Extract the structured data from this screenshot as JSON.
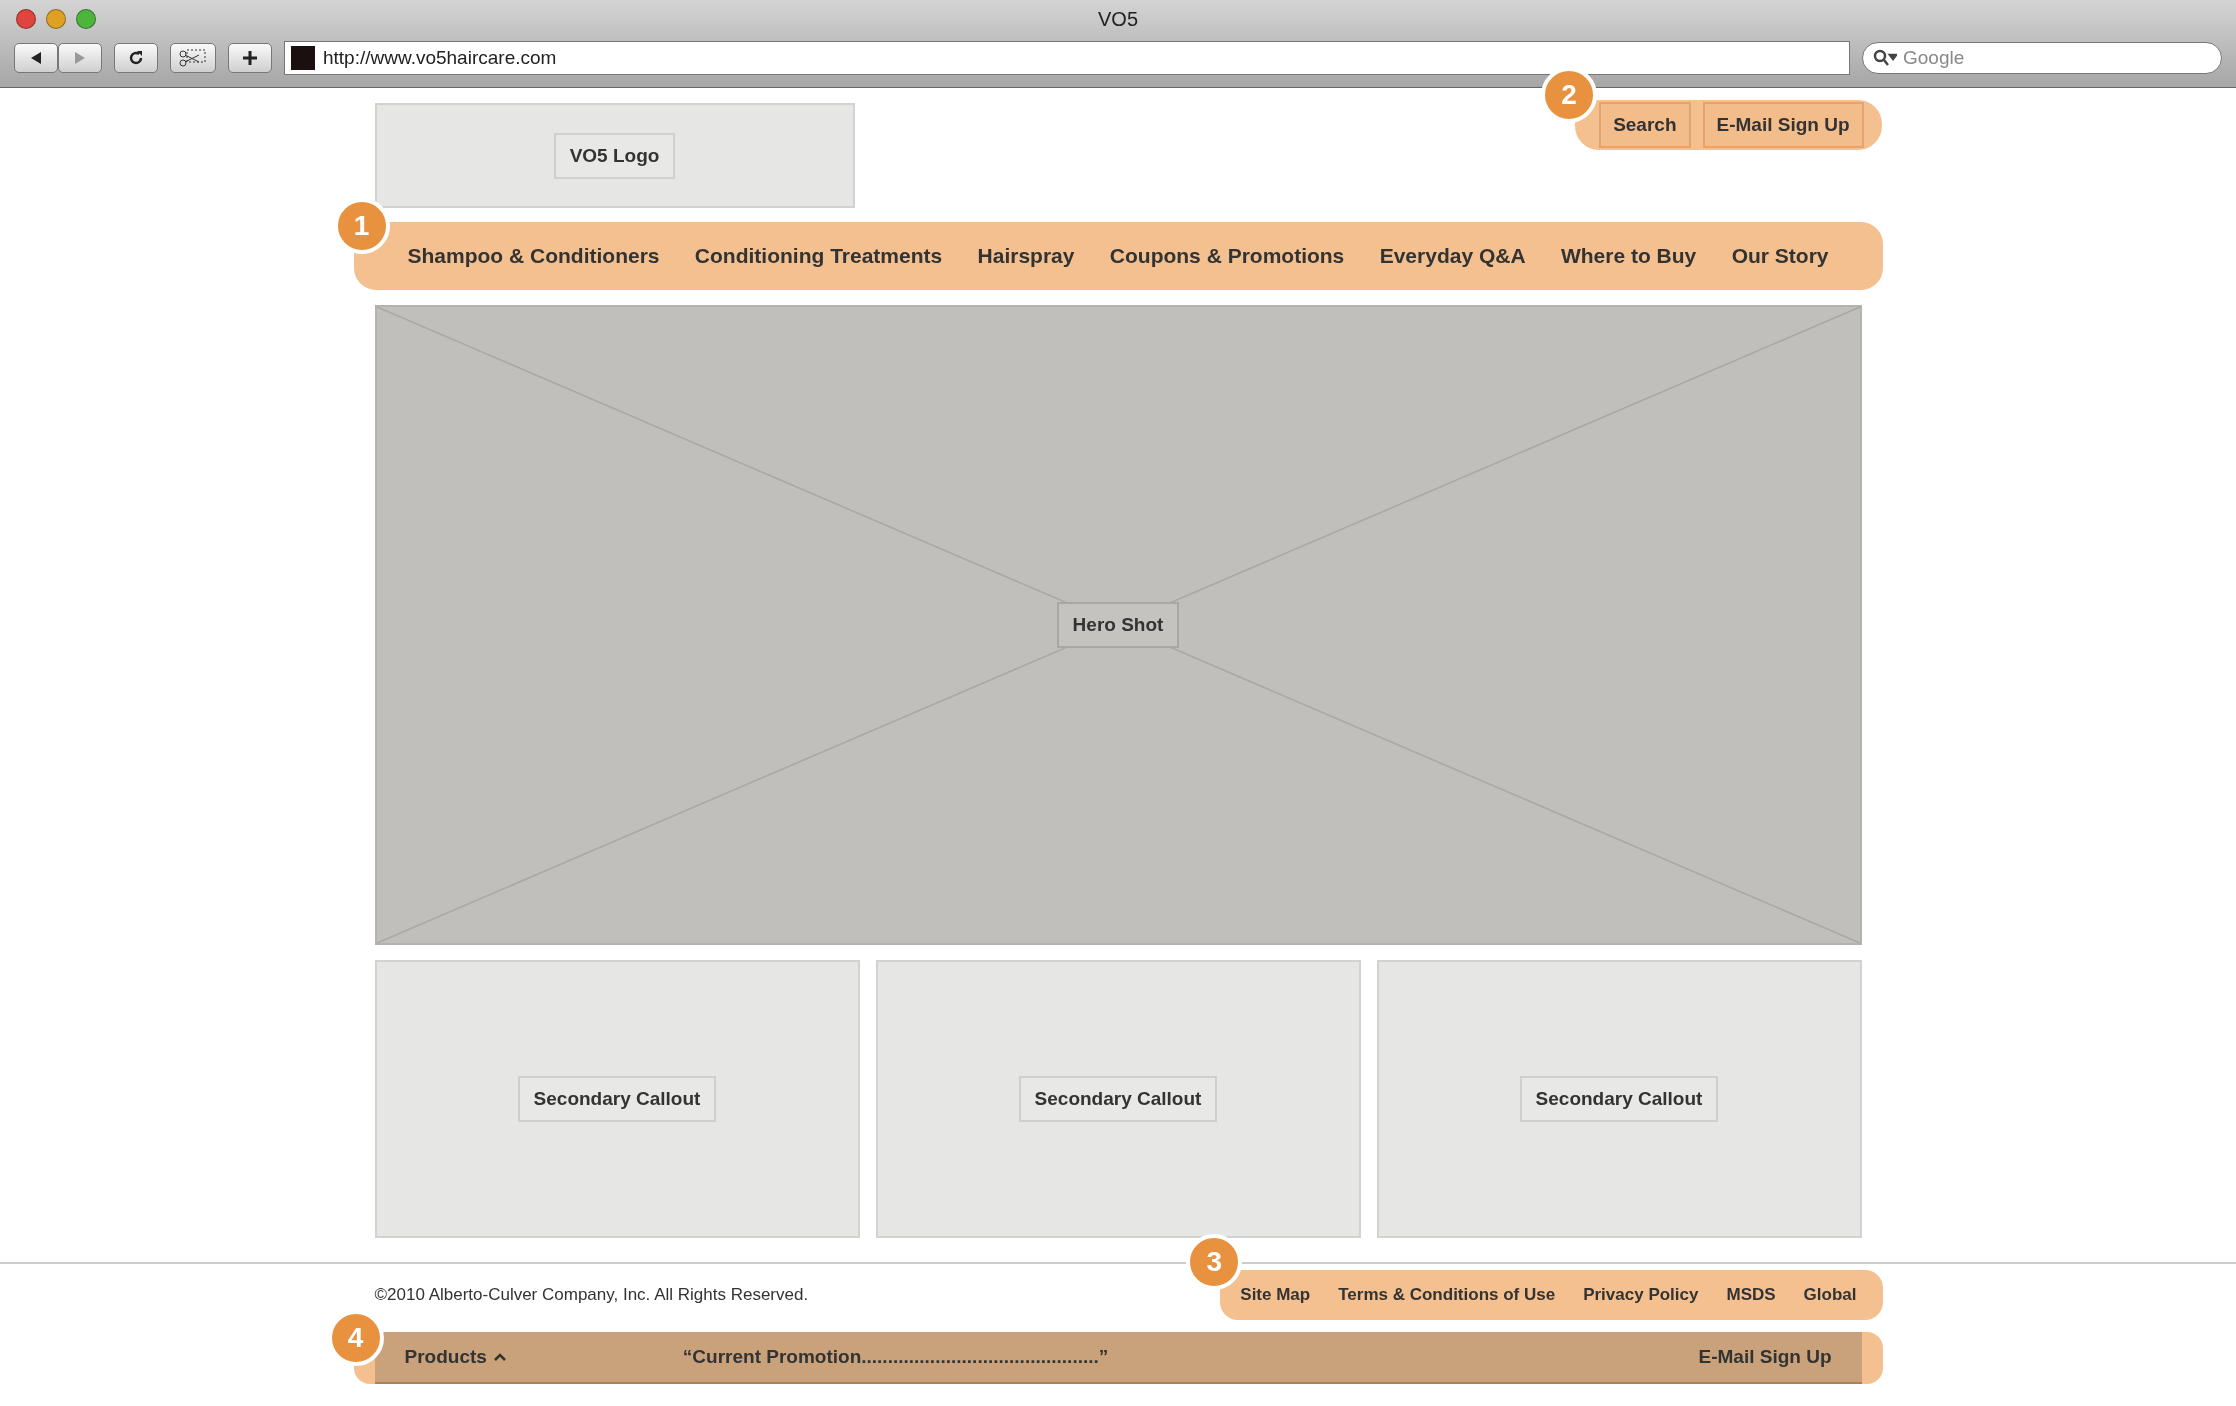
{
  "window": {
    "title": "VO5"
  },
  "toolbar": {
    "url": "http://www.vo5haircare.com",
    "search_placeholder": "Google"
  },
  "logo": "VO5 Logo",
  "utility": {
    "badge": "2",
    "buttons": [
      "Search",
      "E-Mail Sign Up"
    ]
  },
  "nav": {
    "badge": "1",
    "items": [
      "Shampoo & Conditioners",
      "Conditioning Treatments",
      "Hairspray",
      "Coupons & Promotions",
      "Everyday Q&A",
      "Where to Buy",
      "Our Story"
    ]
  },
  "hero": "Hero Shot",
  "callouts": [
    "Secondary Callout",
    "Secondary Callout",
    "Secondary Callout"
  ],
  "footer": {
    "copyright": "©2010 Alberto-Culver Company, Inc. All Rights Reserved.",
    "badge": "3",
    "links": [
      "Site Map",
      "Terms & Conditions of Use",
      "Privacy Policy",
      "MSDS",
      "Global"
    ]
  },
  "promo_bar": {
    "badge": "4",
    "products": "Products",
    "promotion": "“Current Promotion.............................................”",
    "signup": "E-Mail Sign Up"
  }
}
